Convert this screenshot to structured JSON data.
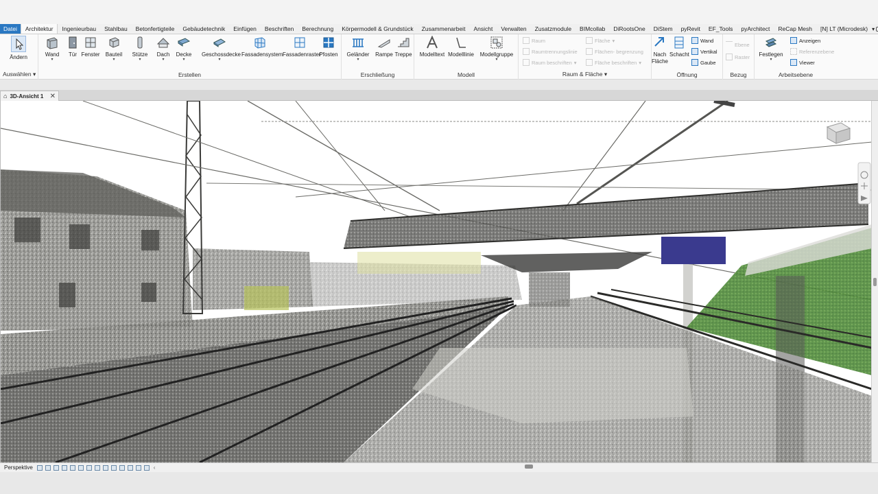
{
  "tabs": [
    {
      "label": "Datei"
    },
    {
      "label": "Architektur"
    },
    {
      "label": "Ingenieurbau"
    },
    {
      "label": "Stahlbau"
    },
    {
      "label": "Betonfertigteile"
    },
    {
      "label": "Gebäudetechnik"
    },
    {
      "label": "Einfügen"
    },
    {
      "label": "Beschriften"
    },
    {
      "label": "Berechnung"
    },
    {
      "label": "Körpermodell & Grundstück"
    },
    {
      "label": "Zusammenarbeit"
    },
    {
      "label": "Ansicht"
    },
    {
      "label": "Verwalten"
    },
    {
      "label": "Zusatzmodule"
    },
    {
      "label": "BIMcollab"
    },
    {
      "label": "DiRootsOne"
    },
    {
      "label": "DiStem"
    },
    {
      "label": "pyRevit"
    },
    {
      "label": "EF_Tools"
    },
    {
      "label": "pyArchitect"
    },
    {
      "label": "ReCap Mesh"
    },
    {
      "label": "[N] LT (Microdesk)"
    }
  ],
  "ribbon": {
    "select": {
      "modify": "Ändern",
      "title": "Auswählen"
    },
    "build": {
      "title": "Erstellen",
      "items": [
        "Wand",
        "Tür",
        "Fenster",
        "Bauteil",
        "Stütze",
        "Dach",
        "Decke",
        "Geschossdecke",
        "Fassadensystem",
        "Fassadenraster",
        "Pfosten"
      ]
    },
    "circulation": {
      "title": "Erschließung",
      "items": [
        "Geländer",
        "Rampe",
        "Treppe"
      ]
    },
    "model": {
      "title": "Modell",
      "items": [
        "Modelltext",
        "Modelllinie",
        "Modellgruppe"
      ]
    },
    "room": {
      "title": "Raum & Fläche",
      "items": [
        "Raum",
        "Raumtrennungslinie",
        "Raum beschriften",
        "Fläche",
        "Flächen- begrenzung",
        "Fläche beschriften"
      ]
    },
    "opening": {
      "title": "Öffnung",
      "items": [
        "Nach Fläche",
        "Schacht",
        "Wand",
        "Vertikal",
        "Gaube"
      ]
    },
    "datum": {
      "title": "Bezug",
      "items": [
        "Ebene",
        "Raster"
      ]
    },
    "workplane": {
      "title": "Arbeitsebene",
      "items": [
        "Festlegen",
        "Anzeigen",
        "Referenzebene",
        "Viewer"
      ]
    }
  },
  "view": {
    "tab_label": "3D-Ansicht 1"
  },
  "status": {
    "perspective": "Perspektive"
  },
  "colors": {
    "accent": "#2a78c2",
    "sign": "#3a3a8e",
    "grass": "#4f8a3a"
  }
}
